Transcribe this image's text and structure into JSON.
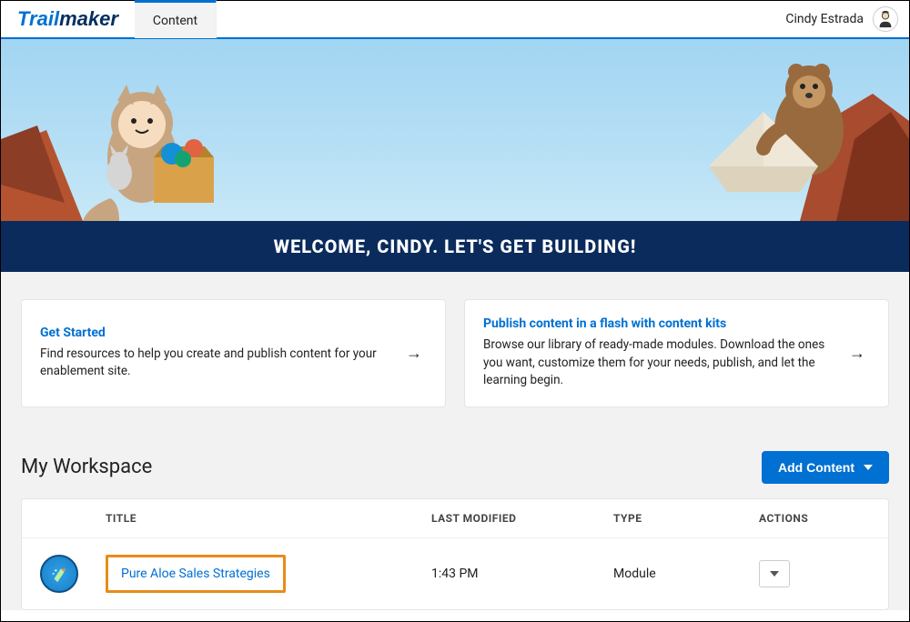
{
  "header": {
    "logo_trail": "Trail",
    "logo_maker": "maker",
    "tab_content": "Content",
    "username": "Cindy Estrada"
  },
  "welcome_message": "Welcome, Cindy. Let's Get Building!",
  "cards": [
    {
      "title": "Get Started",
      "desc": "Find resources to help you create and publish content for your enablement site."
    },
    {
      "title": "Publish content in a flash with content kits",
      "desc": "Browse our library of ready-made modules. Download the ones you want, customize them for your needs, publish, and let the learning begin."
    }
  ],
  "workspace": {
    "heading": "My Workspace",
    "add_button": "Add Content",
    "columns": {
      "title": "TITLE",
      "last_modified": "LAST MODIFIED",
      "type": "TYPE",
      "actions": "ACTIONS"
    },
    "rows": [
      {
        "title": "Pure Aloe Sales Strategies",
        "last_modified": "1:43 PM",
        "type": "Module"
      }
    ]
  }
}
